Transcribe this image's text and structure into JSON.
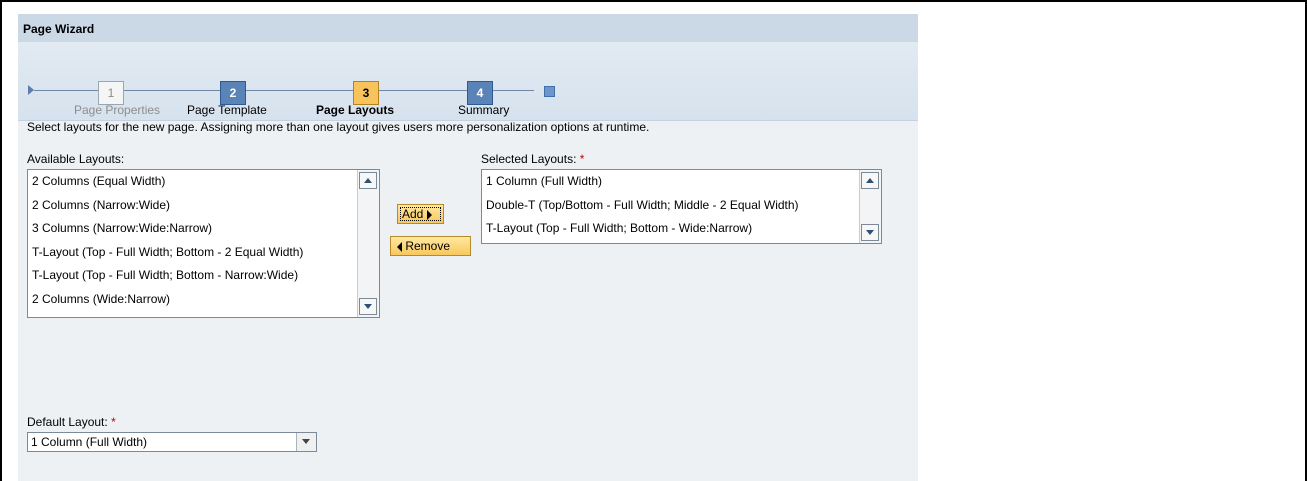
{
  "wizard": {
    "title": "Page Wizard",
    "steps": [
      {
        "number": "1",
        "label": "Page Properties",
        "state": "disabled"
      },
      {
        "number": "2",
        "label": "Page Template",
        "state": "normal"
      },
      {
        "number": "3",
        "label": "Page Layouts",
        "state": "active"
      },
      {
        "number": "4",
        "label": "Summary",
        "state": "normal"
      }
    ]
  },
  "instructions": "Select layouts for the new page. Assigning more than one layout gives users more personalization options at runtime.",
  "available": {
    "label": "Available Layouts:",
    "items": [
      "2 Columns (Equal Width)",
      "2 Columns (Narrow:Wide)",
      "3 Columns (Narrow:Wide:Narrow)",
      "T-Layout (Top - Full Width; Bottom - 2 Equal Width)",
      "T-Layout (Top - Full Width; Bottom - Narrow:Wide)",
      "2 Columns (Wide:Narrow)"
    ]
  },
  "selected": {
    "label": "Selected Layouts:",
    "required_marker": "*",
    "items": [
      "1 Column (Full Width)",
      "Double-T (Top/Bottom - Full Width; Middle - 2 Equal Width)",
      "T-Layout (Top - Full Width; Bottom - Wide:Narrow)"
    ]
  },
  "buttons": {
    "add": "Add",
    "remove": "Remove"
  },
  "default_layout": {
    "label": "Default Layout:",
    "required_marker": "*",
    "value": "1 Column (Full Width)"
  },
  "colors": {
    "title_bar": "#cbd8e6",
    "step_active": "#f7c35a",
    "step_normal": "#5a83b8",
    "required": "#c00000",
    "button": "#f8c85e"
  }
}
